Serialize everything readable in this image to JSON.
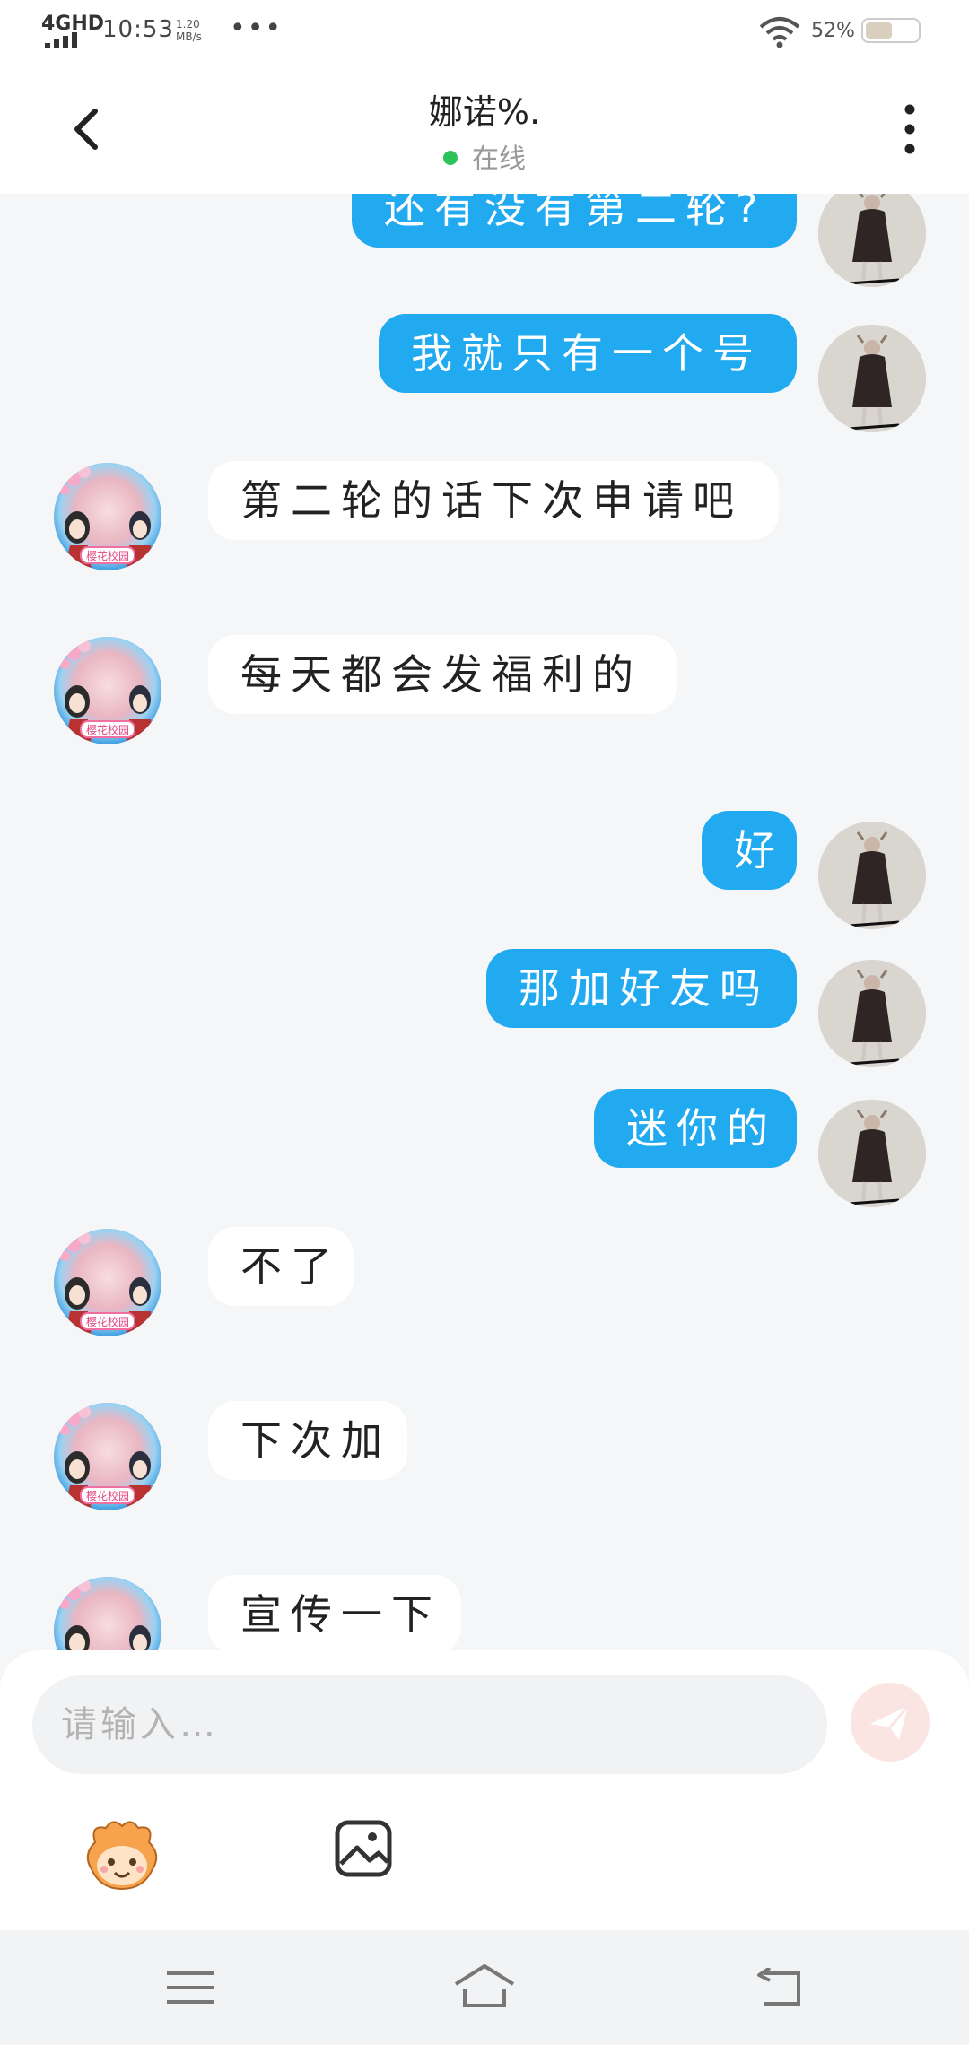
{
  "status_bar": {
    "network": "4GHD",
    "time": "10:53",
    "speed_value": "1.20",
    "speed_unit": "MB/s",
    "more": "•••",
    "battery_pct": "52%",
    "battery_level": 0.52
  },
  "header": {
    "title": "娜诺%.",
    "presence": "在线"
  },
  "messages": [
    {
      "from": "me",
      "text": "还有没有第二轮?"
    },
    {
      "from": "me",
      "text": "我就只有一个号"
    },
    {
      "from": "them",
      "text": "第二轮的话下次申请吧"
    },
    {
      "from": "them",
      "text": "每天都会发福利的"
    },
    {
      "from": "me",
      "text": "好"
    },
    {
      "from": "me",
      "text": "那加好友吗"
    },
    {
      "from": "me",
      "text": "迷你的"
    },
    {
      "from": "them",
      "text": "不了"
    },
    {
      "from": "them",
      "text": "下次加"
    },
    {
      "from": "them",
      "text": "宣传一下"
    }
  ],
  "avatar_badge": "樱花校园",
  "composer": {
    "placeholder": "请输入…"
  },
  "colors": {
    "my_bubble": "#22aaf0",
    "their_bubble": "#ffffff",
    "background": "#f4f6f8",
    "online_dot": "#2ec35a",
    "send_button": "#fbe5e3"
  },
  "icons": {
    "back": "chevron-left-icon",
    "more": "more-vertical-icon",
    "send": "paper-plane-icon",
    "emoji": "emoji-mascot-icon",
    "image": "image-icon",
    "nav_menu": "menu-icon",
    "nav_home": "home-icon",
    "nav_back": "return-icon"
  }
}
